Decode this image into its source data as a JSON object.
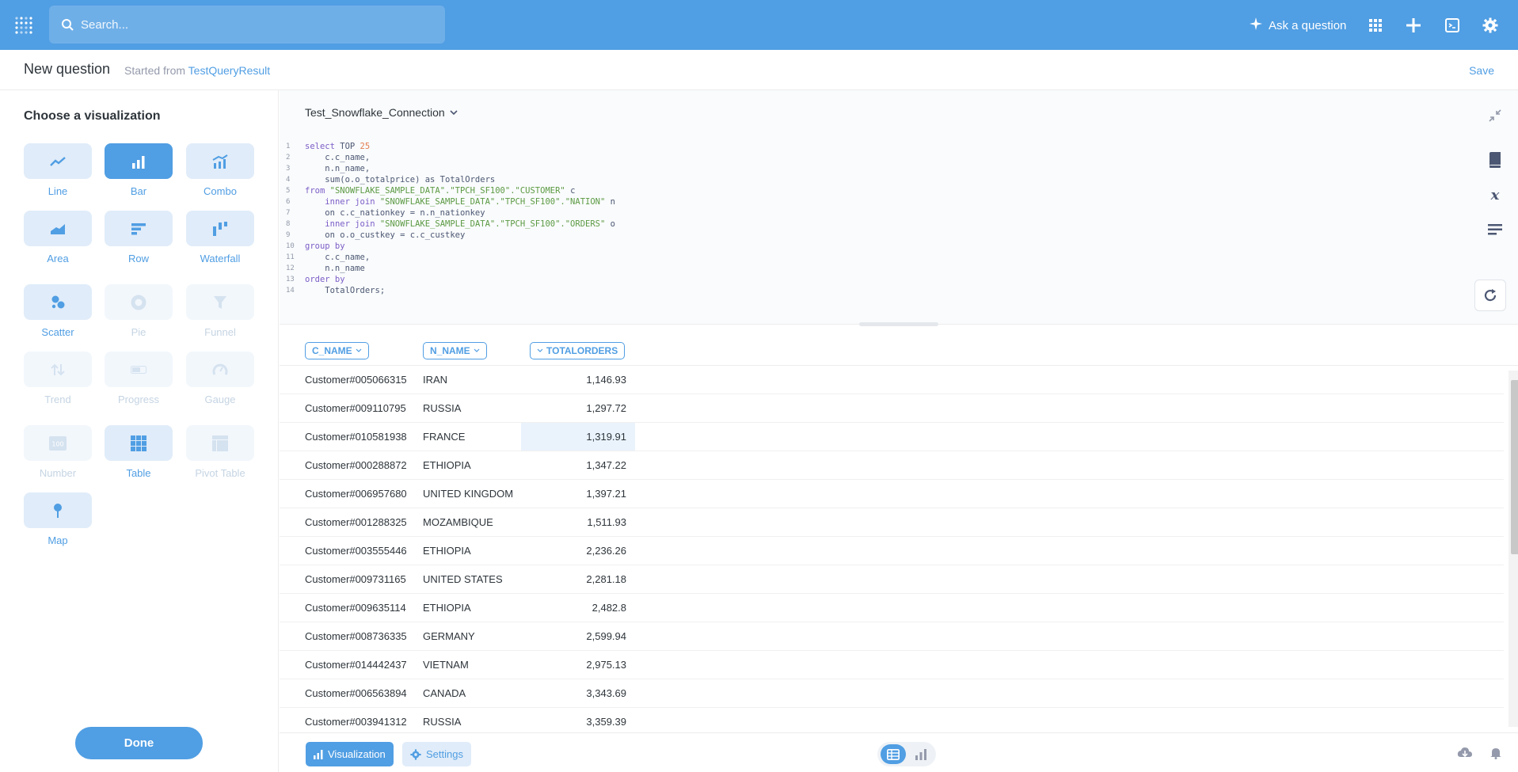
{
  "nav": {
    "search_placeholder": "Search...",
    "ask_label": "Ask a question"
  },
  "header": {
    "title": "New question",
    "subtitle_prefix": "Started from",
    "subtitle_link": "TestQueryResult",
    "save_label": "Save"
  },
  "sidebar": {
    "title": "Choose a visualization",
    "items": [
      {
        "label": "Line",
        "state": "normal"
      },
      {
        "label": "Bar",
        "state": "active"
      },
      {
        "label": "Combo",
        "state": "normal"
      },
      {
        "label": "Area",
        "state": "normal"
      },
      {
        "label": "Row",
        "state": "normal"
      },
      {
        "label": "Waterfall",
        "state": "normal"
      },
      {
        "label": "Scatter",
        "state": "normal"
      },
      {
        "label": "Pie",
        "state": "disabled"
      },
      {
        "label": "Funnel",
        "state": "disabled"
      },
      {
        "label": "Trend",
        "state": "disabled"
      },
      {
        "label": "Progress",
        "state": "disabled"
      },
      {
        "label": "Gauge",
        "state": "disabled"
      },
      {
        "label": "Number",
        "state": "disabled"
      },
      {
        "label": "Table",
        "state": "normal"
      },
      {
        "label": "Pivot Table",
        "state": "disabled"
      },
      {
        "label": "Map",
        "state": "normal"
      }
    ],
    "done_label": "Done"
  },
  "editor": {
    "database": "Test_Snowflake_Connection",
    "lines": [
      {
        "n": "1",
        "parts": [
          [
            "kw",
            "select"
          ],
          [
            "tx",
            " TOP "
          ],
          [
            "num",
            "25"
          ]
        ]
      },
      {
        "n": "2",
        "parts": [
          [
            "tx",
            "    c.c_name,"
          ]
        ]
      },
      {
        "n": "3",
        "parts": [
          [
            "tx",
            "    n.n_name,"
          ]
        ]
      },
      {
        "n": "4",
        "parts": [
          [
            "tx",
            "    sum(o.o_totalprice) as TotalOrders"
          ]
        ]
      },
      {
        "n": "5",
        "parts": [
          [
            "kw",
            "from"
          ],
          [
            "tx",
            " "
          ],
          [
            "str",
            "\"SNOWFLAKE_SAMPLE_DATA\".\"TPCH_SF100\".\"CUSTOMER\""
          ],
          [
            "tx",
            " c"
          ]
        ]
      },
      {
        "n": "6",
        "parts": [
          [
            "tx",
            "    "
          ],
          [
            "kw",
            "inner join"
          ],
          [
            "tx",
            " "
          ],
          [
            "str",
            "\"SNOWFLAKE_SAMPLE_DATA\".\"TPCH_SF100\".\"NATION\""
          ],
          [
            "tx",
            " n"
          ]
        ]
      },
      {
        "n": "7",
        "parts": [
          [
            "tx",
            "    on c.c_nationkey = n.n_nationkey"
          ]
        ]
      },
      {
        "n": "8",
        "parts": [
          [
            "tx",
            "    "
          ],
          [
            "kw",
            "inner join"
          ],
          [
            "tx",
            " "
          ],
          [
            "str",
            "\"SNOWFLAKE_SAMPLE_DATA\".\"TPCH_SF100\".\"ORDERS\""
          ],
          [
            "tx",
            " o"
          ]
        ]
      },
      {
        "n": "9",
        "parts": [
          [
            "tx",
            "    on o.o_custkey = c.c_custkey"
          ]
        ]
      },
      {
        "n": "10",
        "parts": [
          [
            "kw",
            "group by"
          ]
        ]
      },
      {
        "n": "11",
        "parts": [
          [
            "tx",
            "    c.c_name,"
          ]
        ]
      },
      {
        "n": "12",
        "parts": [
          [
            "tx",
            "    n.n_name"
          ]
        ]
      },
      {
        "n": "13",
        "parts": [
          [
            "kw",
            "order by"
          ]
        ]
      },
      {
        "n": "14",
        "parts": [
          [
            "tx",
            "    TotalOrders; "
          ]
        ]
      }
    ]
  },
  "table": {
    "columns": [
      "C_NAME",
      "N_NAME",
      "TOTALORDERS"
    ],
    "rows": [
      [
        "Customer#005066315",
        "IRAN",
        "1,146.93"
      ],
      [
        "Customer#009110795",
        "RUSSIA",
        "1,297.72"
      ],
      [
        "Customer#010581938",
        "FRANCE",
        "1,319.91"
      ],
      [
        "Customer#000288872",
        "ETHIOPIA",
        "1,347.22"
      ],
      [
        "Customer#006957680",
        "UNITED KINGDOM",
        "1,397.21"
      ],
      [
        "Customer#001288325",
        "MOZAMBIQUE",
        "1,511.93"
      ],
      [
        "Customer#003555446",
        "ETHIOPIA",
        "2,236.26"
      ],
      [
        "Customer#009731165",
        "UNITED STATES",
        "2,281.18"
      ],
      [
        "Customer#009635114",
        "ETHIOPIA",
        "2,482.8"
      ],
      [
        "Customer#008736335",
        "GERMANY",
        "2,599.94"
      ],
      [
        "Customer#014442437",
        "VIETNAM",
        "2,975.13"
      ],
      [
        "Customer#006563894",
        "CANADA",
        "3,343.69"
      ],
      [
        "Customer#003941312",
        "RUSSIA",
        "3,359.39"
      ]
    ]
  },
  "footer": {
    "visualization_label": "Visualization",
    "settings_label": "Settings"
  },
  "colors": {
    "brand": "#509ee3",
    "keyword": "#7c5dc8",
    "string": "#5c9a43",
    "number": "#e37e4e"
  }
}
